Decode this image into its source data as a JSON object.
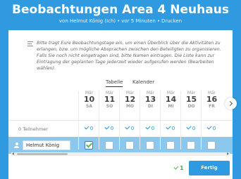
{
  "header": {
    "title": "Beobachtungen Area 4 Neuhaus",
    "author": "von Helmut König (Ich)",
    "time": "vor 5 Minuten",
    "print_label": "Drucken"
  },
  "note": "Bitte tragt Eure Beobachtungstage ein, um einen Überblick über die Aktivitäten zu erlangen, bzw. um mögliche Absprachen zwischen den Beteiligten zu organisieren. Falls Sie noch nicht eingetragen sind, bitte Namen eintragen. Die Liste kann zur Eintragung der geplanten Tage jederzeit wieder aufgerufen werden (Bearbeiten wählen).",
  "tabs": [
    {
      "label": "Tabelle",
      "active": true
    },
    {
      "label": "Kalender",
      "active": false
    }
  ],
  "columns": [
    {
      "month": "Mär",
      "day": "10",
      "weekday": "SA",
      "count": "0"
    },
    {
      "month": "Mär",
      "day": "11",
      "weekday": "SO",
      "count": "0"
    },
    {
      "month": "Mär",
      "day": "12",
      "weekday": "MO",
      "count": "0"
    },
    {
      "month": "Mär",
      "day": "13",
      "weekday": "DI",
      "count": "0"
    },
    {
      "month": "Mär",
      "day": "14",
      "weekday": "MI",
      "count": "0"
    },
    {
      "month": "Mär",
      "day": "15",
      "weekday": "DO",
      "count": "0"
    },
    {
      "month": "Mär",
      "day": "16",
      "weekday": "FR",
      "count": "0"
    }
  ],
  "participants_label": "0 Teilnehmer",
  "my_row": {
    "name": "Helmut König",
    "checked": [
      true,
      false,
      false,
      false,
      false,
      false,
      false
    ]
  },
  "footer": {
    "selected_count": "1",
    "done_label": "Fertig"
  },
  "colors": {
    "background": "#2f9ae0",
    "my_row": "#8cc7ee",
    "accent": "#1a8fd6",
    "check": "#5cb85c"
  }
}
